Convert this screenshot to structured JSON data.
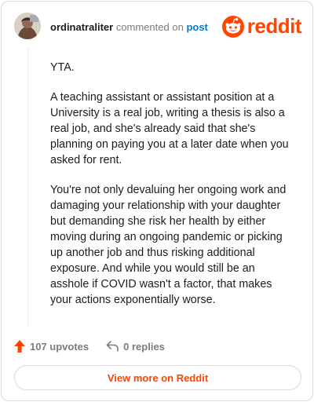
{
  "header": {
    "username": "ordinatraliter",
    "action_text": "commented on",
    "link_text": "post",
    "logo_text": "reddit"
  },
  "comment": {
    "paragraphs": [
      "YTA.",
      "A teaching assistant or assistant position at a University is a real job, writing a thesis is also a real job, and she's already said that she's planning on paying you at a later date when you asked for rent.",
      "You're not only devaluing her ongoing work and damaging your relationship with your daughter but demanding she risk her health by either moving during an ongoing pandemic or picking up another job and thus risking additional exposure. And while you would still be an asshole if COVID wasn't a factor, that makes your actions exponentially worse."
    ]
  },
  "footer": {
    "upvotes": "107 upvotes",
    "replies": "0 replies",
    "view_more": "View more on Reddit"
  },
  "colors": {
    "accent": "#ff4500",
    "link": "#0079d3",
    "muted": "#7c7c7c"
  },
  "icons": [
    "reddit-logo-icon",
    "upvote-arrow-icon",
    "reply-arrow-icon"
  ]
}
